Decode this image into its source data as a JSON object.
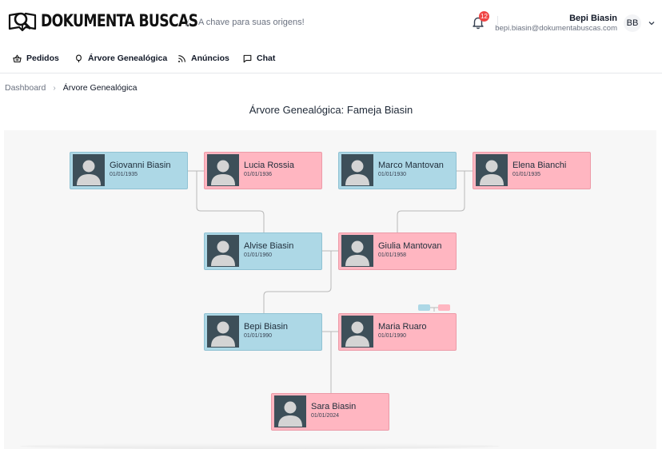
{
  "header": {
    "brand": "DOKUMENTA BUSCAS",
    "separator": "/",
    "tagline": "A chave para suas origens!",
    "notifications_count": "12",
    "user_name": "Bepi Biasin",
    "user_email": "bepi.biasin@dokumentabuscas.com",
    "user_initials": "BB"
  },
  "nav": {
    "items": [
      {
        "label": "Pedidos",
        "icon": "basket-icon"
      },
      {
        "label": "Árvore Genealógica",
        "icon": "tree-icon"
      },
      {
        "label": "Anúncios",
        "icon": "rss-icon"
      },
      {
        "label": "Chat",
        "icon": "chat-icon"
      }
    ]
  },
  "breadcrumb": {
    "home": "Dashboard",
    "separator": "›",
    "current": "Árvore Genealógica"
  },
  "tree": {
    "title": "Árvore Genealógica: Fameja Biasin",
    "colors": {
      "male": "#add8e6",
      "female": "#ffb6c1",
      "photo_bg": "#3d4f59"
    },
    "people": [
      {
        "name": "Giovanni Biasin",
        "date": "01/01/1935",
        "gender": "male"
      },
      {
        "name": "Lucia Rossia",
        "date": "01/01/1936",
        "gender": "female"
      },
      {
        "name": "Marco Mantovan",
        "date": "01/01/1930",
        "gender": "male"
      },
      {
        "name": "Elena Bianchi",
        "date": "01/01/1935",
        "gender": "female"
      },
      {
        "name": "Alvise Biasin",
        "date": "01/01/1960",
        "gender": "male"
      },
      {
        "name": "Giulia Mantovan",
        "date": "01/01/1958",
        "gender": "female"
      },
      {
        "name": "Bepi Biasin",
        "date": "01/01/1990",
        "gender": "male"
      },
      {
        "name": "Maria Ruaro",
        "date": "01/01/1990",
        "gender": "female"
      },
      {
        "name": "Sara Biasin",
        "date": "01/01/2024",
        "gender": "female"
      }
    ]
  }
}
